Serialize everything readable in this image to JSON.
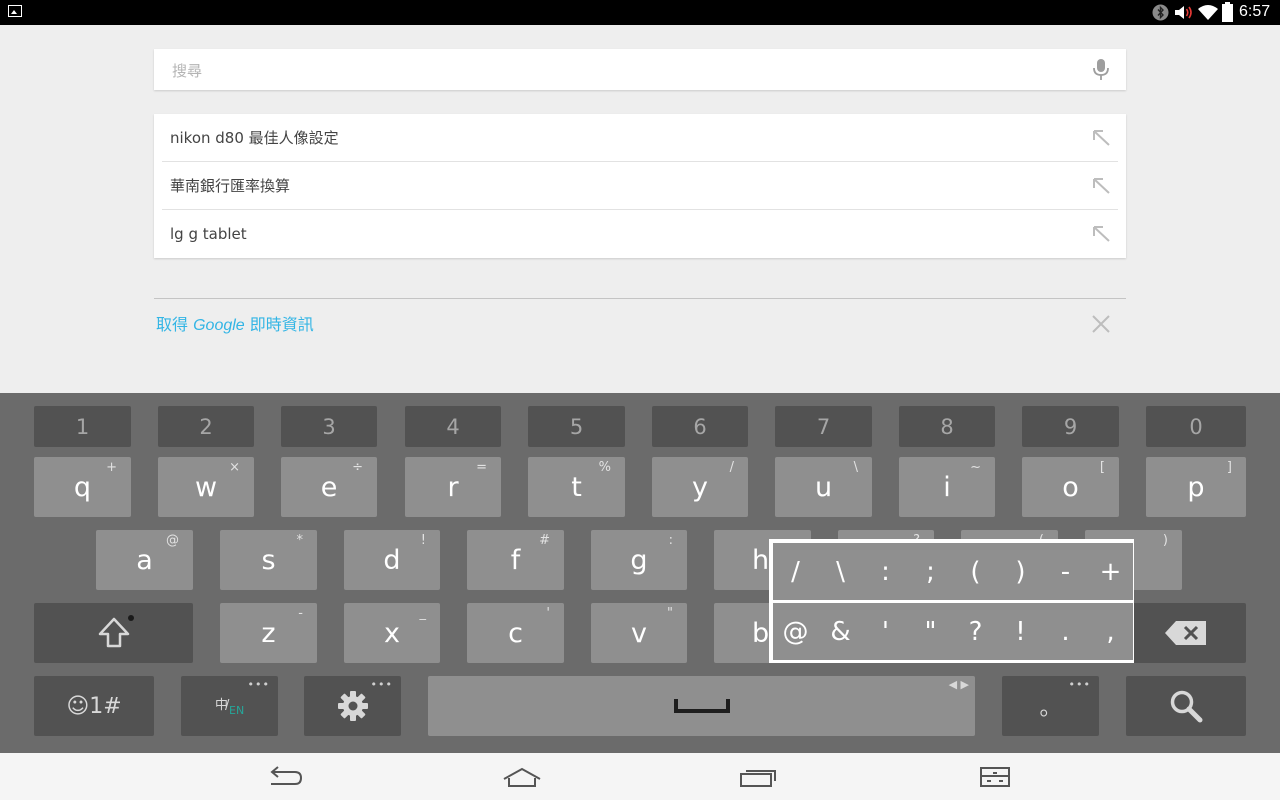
{
  "status_bar": {
    "time": "6:57",
    "icons": [
      "gallery-icon",
      "bluetooth-icon",
      "volume-icon",
      "wifi-icon",
      "battery-icon"
    ]
  },
  "search": {
    "placeholder": "搜尋",
    "value": "",
    "mic_icon": "microphone-icon"
  },
  "suggestions": [
    {
      "text": "nikon d80 最佳人像設定",
      "icon": "arrow-up-left-icon"
    },
    {
      "text": "華南銀行匯率換算",
      "icon": "arrow-up-left-icon"
    },
    {
      "text": "lg g tablet",
      "icon": "arrow-up-left-icon"
    }
  ],
  "google_now": {
    "prefix": "取得 ",
    "brand": "Google",
    "suffix": " 即時資訊",
    "close_icon": "close-icon",
    "color": "#33b5e5"
  },
  "keyboard": {
    "numbers": [
      "1",
      "2",
      "3",
      "4",
      "5",
      "6",
      "7",
      "8",
      "9",
      "0"
    ],
    "row_q": [
      {
        "main": "q",
        "sub": "+"
      },
      {
        "main": "w",
        "sub": "×"
      },
      {
        "main": "e",
        "sub": "÷"
      },
      {
        "main": "r",
        "sub": "="
      },
      {
        "main": "t",
        "sub": "%"
      },
      {
        "main": "y",
        "sub": "/"
      },
      {
        "main": "u",
        "sub": "\\"
      },
      {
        "main": "i",
        "sub": "~"
      },
      {
        "main": "o",
        "sub": "["
      },
      {
        "main": "p",
        "sub": "]"
      }
    ],
    "row_a": [
      {
        "main": "a",
        "sub": "@"
      },
      {
        "main": "s",
        "sub": "*"
      },
      {
        "main": "d",
        "sub": "!"
      },
      {
        "main": "f",
        "sub": "#"
      },
      {
        "main": "g",
        "sub": ":"
      },
      {
        "main": "h",
        "sub": ""
      },
      {
        "main": "",
        "sub": "?"
      },
      {
        "main": "",
        "sub": "("
      },
      {
        "main": "",
        "sub": ")"
      }
    ],
    "row_z": [
      {
        "main": "z",
        "sub": "-"
      },
      {
        "main": "x",
        "sub": "_"
      },
      {
        "main": "c",
        "sub": "'"
      },
      {
        "main": "v",
        "sub": "\""
      },
      {
        "main": "b",
        "sub": ""
      }
    ],
    "bottom": {
      "emoji_label": "☺1#",
      "lang_zh": "中",
      "lang_en": "EN",
      "dots": "•••",
      "period": "。",
      "space_arrows": "◀ ▶"
    },
    "popup_row1": [
      "/",
      "\\",
      ":",
      ";",
      "(",
      ")",
      "-",
      "+"
    ],
    "popup_row2": [
      "@",
      "&",
      "'",
      "\"",
      "?",
      "!",
      ".",
      ","
    ]
  },
  "nav_bar": {
    "buttons": [
      "back-icon",
      "home-icon",
      "recent-apps-icon",
      "keyboard-switch-icon"
    ]
  }
}
